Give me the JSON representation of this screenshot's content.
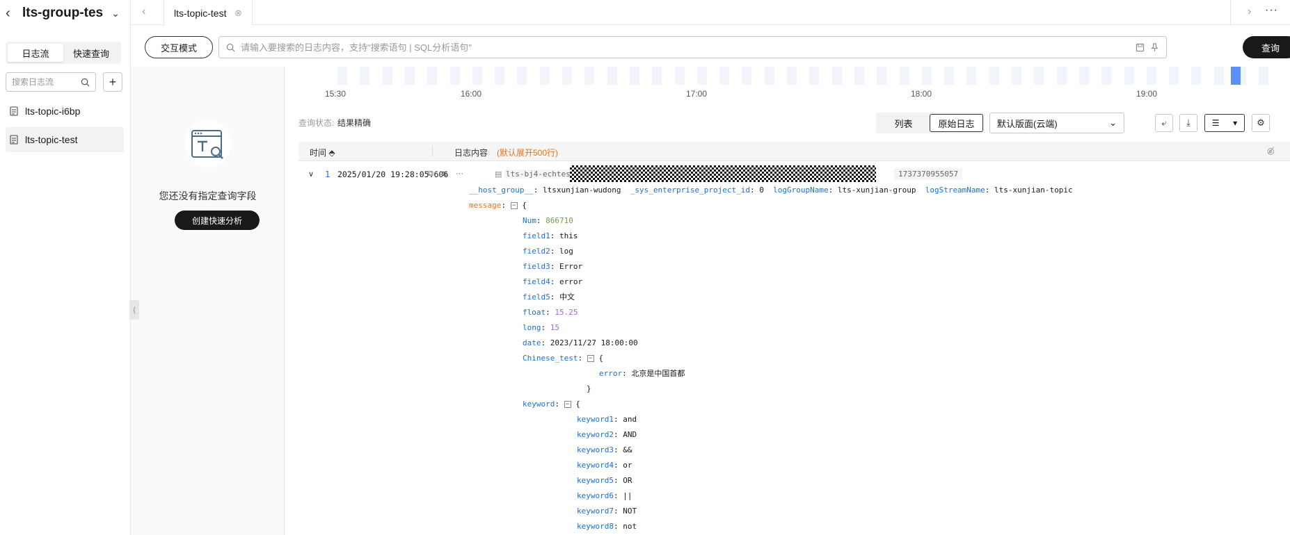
{
  "sidebar": {
    "group_title": "lts-group-tes",
    "tabs": [
      {
        "label": "日志流",
        "active": true
      },
      {
        "label": "快速查询",
        "active": false
      }
    ],
    "search_placeholder": "搜索日志流",
    "streams": [
      {
        "label": "lts-topic-i6bp",
        "active": false
      },
      {
        "label": "lts-topic-test",
        "active": true
      }
    ]
  },
  "tabs": {
    "active_tab": "lts-topic-test"
  },
  "query": {
    "mode_button": "交互模式",
    "placeholder": "请输入要搜索的日志内容，支持\"搜索语句 | SQL分析语句\"",
    "value": "",
    "query_button": "查询"
  },
  "field_panel": {
    "empty_text": "您还没有指定查询字段",
    "create_button": "创建快速分析"
  },
  "histogram": {
    "ticks": [
      "15:30",
      "16:00",
      "17:00",
      "18:00",
      "19:00"
    ]
  },
  "status": {
    "label": "查询状态:",
    "value": "结果精确"
  },
  "view": {
    "modes": [
      {
        "label": "列表",
        "active": false
      },
      {
        "label": "原始日志",
        "active": true
      }
    ],
    "layout_select": "默认版面(云端)"
  },
  "table": {
    "col_time": "时间",
    "col_content": "日志内容",
    "col_note": "(默认展开500行)"
  },
  "log": {
    "index": "1",
    "time": "2025/01/20 19:28:05.606",
    "source_prefix": "lts-bj4-echtes",
    "source_suffix": "1737370955057",
    "meta": [
      {
        "k": "__host_group__",
        "v": "ltsxunjian-wudong"
      },
      {
        "k": "_sys_enterprise_project_id",
        "v": "0"
      },
      {
        "k": "logGroupName",
        "v": "lts-xunjian-group"
      },
      {
        "k": "logStreamName",
        "v": "lts-xunjian-topic"
      }
    ],
    "message_key": "message",
    "fields": [
      {
        "k": "Num",
        "v": "866710",
        "t": "n"
      },
      {
        "k": "field1",
        "v": "this",
        "t": "s"
      },
      {
        "k": "field2",
        "v": "log",
        "t": "s"
      },
      {
        "k": "field3",
        "v": "Error",
        "t": "s"
      },
      {
        "k": "field4",
        "v": "error",
        "t": "s"
      },
      {
        "k": "field5",
        "v": "中文",
        "t": "s"
      },
      {
        "k": "float",
        "v": "15.25",
        "t": "f"
      },
      {
        "k": "long",
        "v": "15",
        "t": "f"
      },
      {
        "k": "date",
        "v": "2023/11/27 18:00:00",
        "t": "s"
      }
    ],
    "chinese_test_key": "Chinese_test",
    "chinese_test": {
      "k": "error",
      "v": "北京是中国首都"
    },
    "keyword_key": "keyword",
    "keywords": [
      {
        "k": "keyword1",
        "v": "and"
      },
      {
        "k": "keyword2",
        "v": "AND"
      },
      {
        "k": "keyword3",
        "v": "&&"
      },
      {
        "k": "keyword4",
        "v": "or"
      },
      {
        "k": "keyword5",
        "v": "OR"
      },
      {
        "k": "keyword6",
        "v": "||"
      },
      {
        "k": "keyword7",
        "v": "NOT"
      },
      {
        "k": "keyword8",
        "v": "not"
      }
    ]
  }
}
